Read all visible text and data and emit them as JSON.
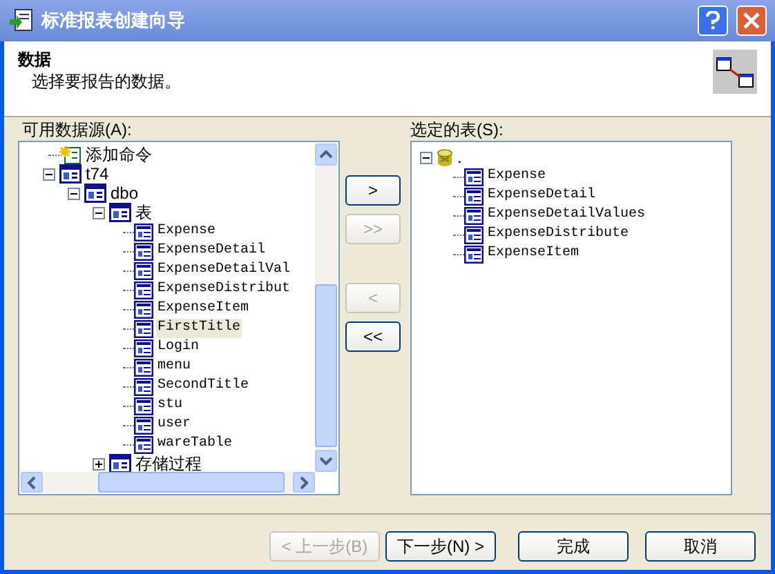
{
  "window": {
    "title": "标准报表创建向导"
  },
  "header": {
    "title": "数据",
    "subtitle": "选择要报告的数据。"
  },
  "available_label": "可用数据源(A):",
  "selected_label": "选定的表(S):",
  "available_tree": [
    {
      "label": "添加命令",
      "kind": "command",
      "selected": false
    },
    {
      "label": "t74",
      "kind": "schema",
      "selected": false,
      "expanded": true,
      "children": [
        {
          "label": "dbo",
          "kind": "schema",
          "selected": false,
          "expanded": true,
          "children": [
            {
              "label": "表",
              "kind": "schema",
              "selected": false,
              "expanded": true,
              "children": [
                {
                  "label": "Expense",
                  "kind": "table",
                  "selected": false
                },
                {
                  "label": "ExpenseDetail",
                  "kind": "table",
                  "selected": false
                },
                {
                  "label": "ExpenseDetailVal",
                  "kind": "table",
                  "selected": false
                },
                {
                  "label": "ExpenseDistribut",
                  "kind": "table",
                  "selected": false
                },
                {
                  "label": "ExpenseItem",
                  "kind": "table",
                  "selected": false
                },
                {
                  "label": "FirstTitle",
                  "kind": "table",
                  "selected": true
                },
                {
                  "label": "Login",
                  "kind": "table",
                  "selected": false
                },
                {
                  "label": "menu",
                  "kind": "table",
                  "selected": false
                },
                {
                  "label": "SecondTitle",
                  "kind": "table",
                  "selected": false
                },
                {
                  "label": "stu",
                  "kind": "table",
                  "selected": false
                },
                {
                  "label": "user",
                  "kind": "table",
                  "selected": false
                },
                {
                  "label": "wareTable",
                  "kind": "table",
                  "selected": false
                }
              ]
            },
            {
              "label": "存储过程",
              "kind": "schema",
              "selected": false,
              "expanded": false
            }
          ]
        }
      ]
    }
  ],
  "move_buttons": [
    {
      "label": ">",
      "disabled": false
    },
    {
      "label": ">>",
      "disabled": true
    },
    {
      "label": "<",
      "disabled": true
    },
    {
      "label": "<<",
      "disabled": false
    }
  ],
  "selected_tree": [
    {
      "label": ".",
      "kind": "database",
      "selected": false,
      "expanded": true,
      "children": [
        {
          "label": "Expense",
          "kind": "table",
          "selected": false
        },
        {
          "label": "ExpenseDetail",
          "kind": "table",
          "selected": false
        },
        {
          "label": "ExpenseDetailValues",
          "kind": "table",
          "selected": false
        },
        {
          "label": "ExpenseDistribute",
          "kind": "table",
          "selected": false
        },
        {
          "label": "ExpenseItem",
          "kind": "table",
          "selected": false
        }
      ]
    }
  ],
  "buttons": [
    {
      "label": "< 上一步(B)",
      "disabled": true
    },
    {
      "label": "下一步(N) >",
      "disabled": false
    },
    {
      "label": "完成",
      "disabled": false
    },
    {
      "label": "取消",
      "disabled": false
    }
  ]
}
